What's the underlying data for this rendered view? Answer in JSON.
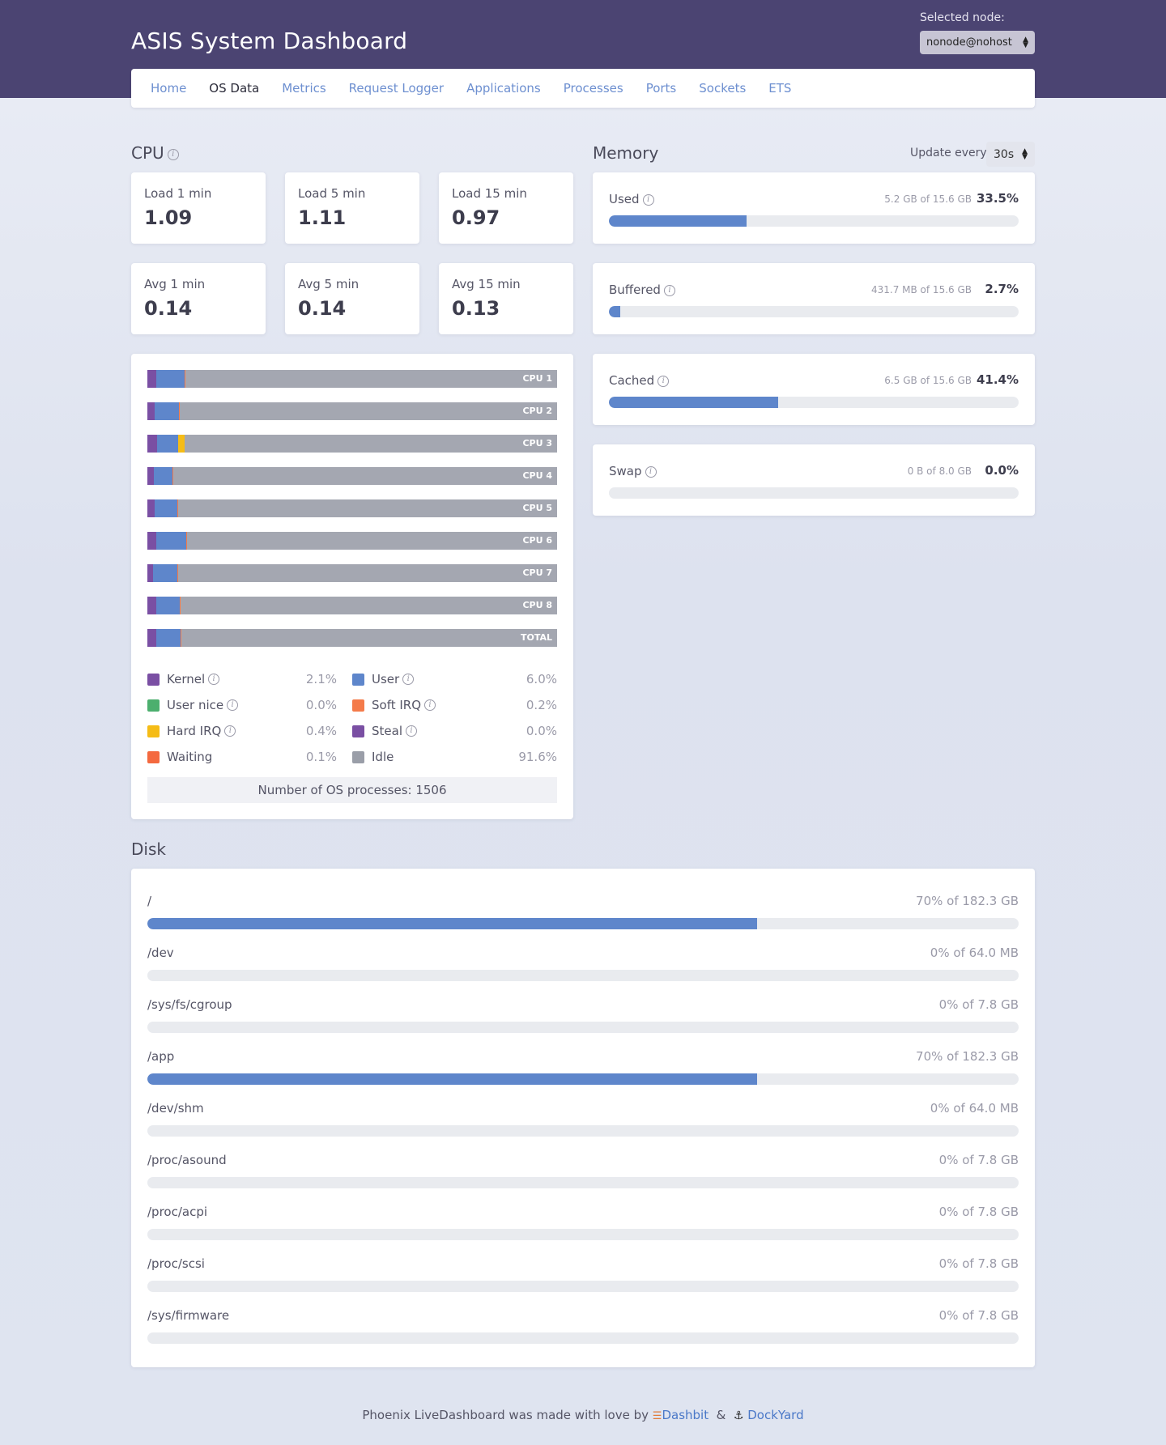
{
  "header": {
    "title": "ASIS System Dashboard",
    "node_label": "Selected node:",
    "node_value": "nonode@nohost"
  },
  "nav": [
    {
      "label": "Home",
      "active": false
    },
    {
      "label": "OS Data",
      "active": true
    },
    {
      "label": "Metrics",
      "active": false
    },
    {
      "label": "Request Logger",
      "active": false
    },
    {
      "label": "Applications",
      "active": false
    },
    {
      "label": "Processes",
      "active": false
    },
    {
      "label": "Ports",
      "active": false
    },
    {
      "label": "Sockets",
      "active": false
    },
    {
      "label": "ETS",
      "active": false
    }
  ],
  "cpu": {
    "title": "CPU",
    "stats": [
      {
        "label": "Load 1 min",
        "value": "1.09"
      },
      {
        "label": "Load 5 min",
        "value": "1.11"
      },
      {
        "label": "Load 15 min",
        "value": "0.97"
      },
      {
        "label": "Avg 1 min",
        "value": "0.14"
      },
      {
        "label": "Avg 5 min",
        "value": "0.14"
      },
      {
        "label": "Avg 15 min",
        "value": "0.13"
      }
    ],
    "bars": [
      {
        "label": "CPU 1",
        "kernel": 2.1,
        "user": 6.9,
        "hard_irq": 0,
        "soft_irq": 0.3
      },
      {
        "label": "CPU 2",
        "kernel": 1.8,
        "user": 6.0,
        "hard_irq": 0,
        "soft_irq": 0.2
      },
      {
        "label": "CPU 3",
        "kernel": 2.3,
        "user": 5.2,
        "hard_irq": 1.6,
        "soft_irq": 0
      },
      {
        "label": "CPU 4",
        "kernel": 1.5,
        "user": 4.6,
        "hard_irq": 0,
        "soft_irq": 0.2
      },
      {
        "label": "CPU 5",
        "kernel": 1.8,
        "user": 5.6,
        "hard_irq": 0,
        "soft_irq": 0.2
      },
      {
        "label": "CPU 6",
        "kernel": 2.1,
        "user": 7.3,
        "hard_irq": 0,
        "soft_irq": 0.3
      },
      {
        "label": "CPU 7",
        "kernel": 1.4,
        "user": 6.0,
        "hard_irq": 0,
        "soft_irq": 0.2
      },
      {
        "label": "CPU 8",
        "kernel": 2.1,
        "user": 5.8,
        "hard_irq": 0,
        "soft_irq": 0.2
      },
      {
        "label": "TOTAL",
        "kernel": 2.1,
        "user": 6.0,
        "hard_irq": 0.1,
        "soft_irq": 0.2
      }
    ],
    "legend": [
      [
        {
          "label": "Kernel",
          "pct": "2.1%",
          "color": "#7a4fa3",
          "info": true
        },
        {
          "label": "User",
          "pct": "6.0%",
          "color": "#5e86cb",
          "info": true
        }
      ],
      [
        {
          "label": "User nice",
          "pct": "0.0%",
          "color": "#4caf6e",
          "info": true
        },
        {
          "label": "Soft IRQ",
          "pct": "0.2%",
          "color": "#f47b4a",
          "info": true
        }
      ],
      [
        {
          "label": "Hard IRQ",
          "pct": "0.4%",
          "color": "#f5bc16",
          "info": true
        },
        {
          "label": "Steal",
          "pct": "0.0%",
          "color": "#7a4fa3",
          "info": true
        }
      ],
      [
        {
          "label": "Waiting",
          "pct": "0.1%",
          "color": "#f4693f",
          "info": false
        },
        {
          "label": "Idle",
          "pct": "91.6%",
          "color": "#9a9ea8",
          "info": false
        }
      ]
    ],
    "process_count": "Number of OS processes: 1506"
  },
  "memory": {
    "title": "Memory",
    "update_label": "Update every",
    "update_value": "30s",
    "items": [
      {
        "label": "Used",
        "detail": "5.2 GB of 15.6 GB",
        "pct": "33.5%",
        "fraction": 0.335
      },
      {
        "label": "Buffered",
        "detail": "431.7 MB of 15.6 GB",
        "pct": "2.7%",
        "fraction": 0.027
      },
      {
        "label": "Cached",
        "detail": "6.5 GB of 15.6 GB",
        "pct": "41.4%",
        "fraction": 0.414
      },
      {
        "label": "Swap",
        "detail": "0 B of 8.0 GB",
        "pct": "0.0%",
        "fraction": 0.0
      }
    ]
  },
  "disk": {
    "title": "Disk",
    "items": [
      {
        "mount": "/",
        "usage": "70% of 182.3 GB",
        "fraction": 0.7
      },
      {
        "mount": "/dev",
        "usage": "0% of 64.0 MB",
        "fraction": 0.0
      },
      {
        "mount": "/sys/fs/cgroup",
        "usage": "0% of 7.8 GB",
        "fraction": 0.0
      },
      {
        "mount": "/app",
        "usage": "70% of 182.3 GB",
        "fraction": 0.7
      },
      {
        "mount": "/dev/shm",
        "usage": "0% of 64.0 MB",
        "fraction": 0.0
      },
      {
        "mount": "/proc/asound",
        "usage": "0% of 7.8 GB",
        "fraction": 0.0
      },
      {
        "mount": "/proc/acpi",
        "usage": "0% of 7.8 GB",
        "fraction": 0.0
      },
      {
        "mount": "/proc/scsi",
        "usage": "0% of 7.8 GB",
        "fraction": 0.0
      },
      {
        "mount": "/sys/firmware",
        "usage": "0% of 7.8 GB",
        "fraction": 0.0
      }
    ]
  },
  "footer": {
    "text": "Phoenix LiveDashboard was made with love by",
    "link1": "Dashbit",
    "amp": "&",
    "link2": "DockYard"
  },
  "colors": {
    "banner": "#4b4472",
    "accent": "#5e86cb",
    "kernel": "#7a4fa3",
    "user": "#5e86cb",
    "hard_irq": "#f5bc16",
    "soft_irq": "#f47b4a",
    "idle": "#a4a7b1"
  }
}
